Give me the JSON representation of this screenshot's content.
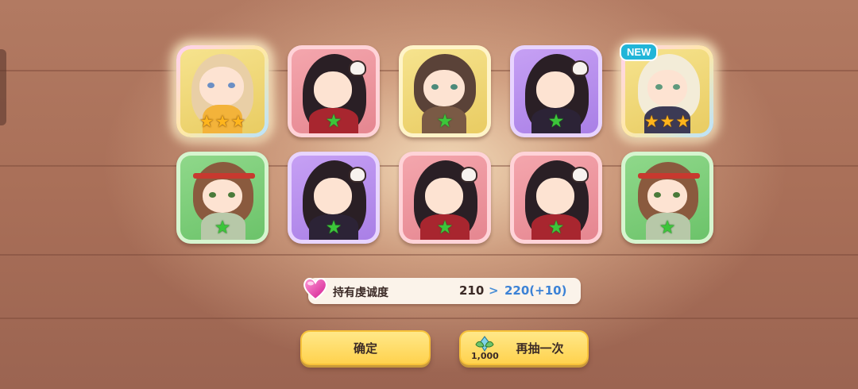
{
  "results": [
    {
      "id": "c1",
      "frame": "gold",
      "rarity": 3,
      "is_new": false,
      "highlight": true
    },
    {
      "id": "c2",
      "frame": "pink",
      "rarity": 1,
      "is_new": false
    },
    {
      "id": "c3",
      "frame": "yellow",
      "rarity": 1,
      "is_new": false
    },
    {
      "id": "c4",
      "frame": "purple",
      "rarity": 1,
      "is_new": false
    },
    {
      "id": "c5",
      "frame": "gold",
      "rarity": 3,
      "is_new": true,
      "highlight": true
    },
    {
      "id": "c6",
      "frame": "green",
      "rarity": 1,
      "is_new": false
    },
    {
      "id": "c7",
      "frame": "purple",
      "rarity": 1,
      "is_new": false
    },
    {
      "id": "c8",
      "frame": "pink",
      "rarity": 1,
      "is_new": false
    },
    {
      "id": "c9",
      "frame": "pink",
      "rarity": 1,
      "is_new": false
    },
    {
      "id": "c10",
      "frame": "green",
      "rarity": 1,
      "is_new": false
    }
  ],
  "badge_new": "NEW",
  "stat": {
    "icon": "heart-gem-icon",
    "label": "持有虔诚度",
    "old_value": "210",
    "arrow": ">",
    "new_value": "220(+10)"
  },
  "buttons": {
    "confirm": "确定",
    "redraw": "再抽一次",
    "redraw_cost": "1,000",
    "redraw_cost_icon": "leaf-crystal-icon"
  },
  "colors": {
    "button_fill": "#ffd24e",
    "stat_increase": "#3c82d6",
    "new_badge": "#21b5d8"
  }
}
